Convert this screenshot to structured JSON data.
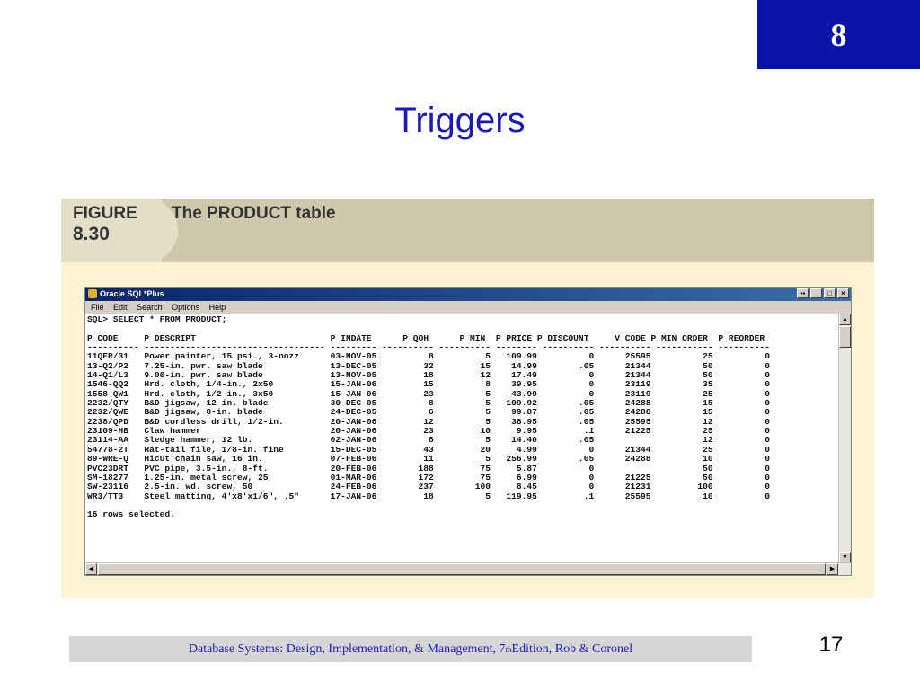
{
  "slide": {
    "chapter": "8",
    "title": "Triggers",
    "page_number": "17",
    "footer_pre": "Database Systems: Design, Implementation, & Management, 7",
    "footer_sup": "th",
    "footer_post": " Edition, Rob & Coronel"
  },
  "figure": {
    "label": "FIGURE",
    "number": "8.30",
    "caption": "The PRODUCT table"
  },
  "window": {
    "title": "Oracle SQL*Plus",
    "menu": [
      "File",
      "Edit",
      "Search",
      "Options",
      "Help"
    ],
    "controls": [
      "▪▪",
      "_",
      "□",
      "×"
    ]
  },
  "console": {
    "prompt": "SQL> SELECT * FROM PRODUCT;",
    "header": "P_CODE     P_DESCRIPT                          P_INDATE      P_QOH      P_MIN  P_PRICE P_DISCOUNT     V_CODE P_MIN_ORDER  P_REORDER",
    "separator": "---------- ----------------------------------- --------- ---------- ---------- -------- ---------- ---------- ----------- ----------",
    "rows": [
      "11QER/31   Power painter, 15 psi., 3-nozz      03-NOV-05          8          5   109.99          0      25595          25          0",
      "13-Q2/P2   7.25-in. pwr. saw blade             13-DEC-05         32         15    14.99        .05      21344          50          0",
      "14-Q1/L3   9.00-in. pwr. saw blade             13-NOV-05         18         12    17.49          0      21344          50          0",
      "1546-QQ2   Hrd. cloth, 1/4-in., 2x50           15-JAN-06         15          8    39.95          0      23119          35          0",
      "1558-QW1   Hrd. cloth, 1/2-in., 3x50           15-JAN-06         23          5    43.99          0      23119          25          0",
      "2232/QTY   B&D jigsaw, 12-in. blade            30-DEC-05          8          5   109.92        .05      24288          15          0",
      "2232/QWE   B&D jigsaw, 8-in. blade             24-DEC-05          6          5    99.87        .05      24288          15          0",
      "2238/QPD   B&D cordless drill, 1/2-in.         20-JAN-06         12          5    38.95        .05      25595          12          0",
      "23109-HB   Claw hammer                         20-JAN-06         23         10     9.95         .1      21225          25          0",
      "23114-AA   Sledge hammer, 12 lb.               02-JAN-06          8          5    14.40        .05                     12          0",
      "54778-2T   Rat-tail file, 1/8-in. fine         15-DEC-05         43         20     4.99          0      21344          25          0",
      "89-WRE-Q   Hicut chain saw, 16 in.             07-FEB-06         11          5   256.99        .05      24288          10          0",
      "PVC23DRT   PVC pipe, 3.5-in., 8-ft.            20-FEB-06        188         75     5.87          0                     50          0",
      "SM-18277   1.25-in. metal screw, 25            01-MAR-06        172         75     6.99          0      21225          50          0",
      "SW-23116   2.5-in. wd. screw, 50               24-FEB-06        237        100     8.45          0      21231         100          0",
      "WR3/TT3    Steel matting, 4'x8'x1/6\", .5\"      17-JAN-06         18          5   119.95         .1      25595          10          0"
    ],
    "summary": "16 rows selected."
  }
}
